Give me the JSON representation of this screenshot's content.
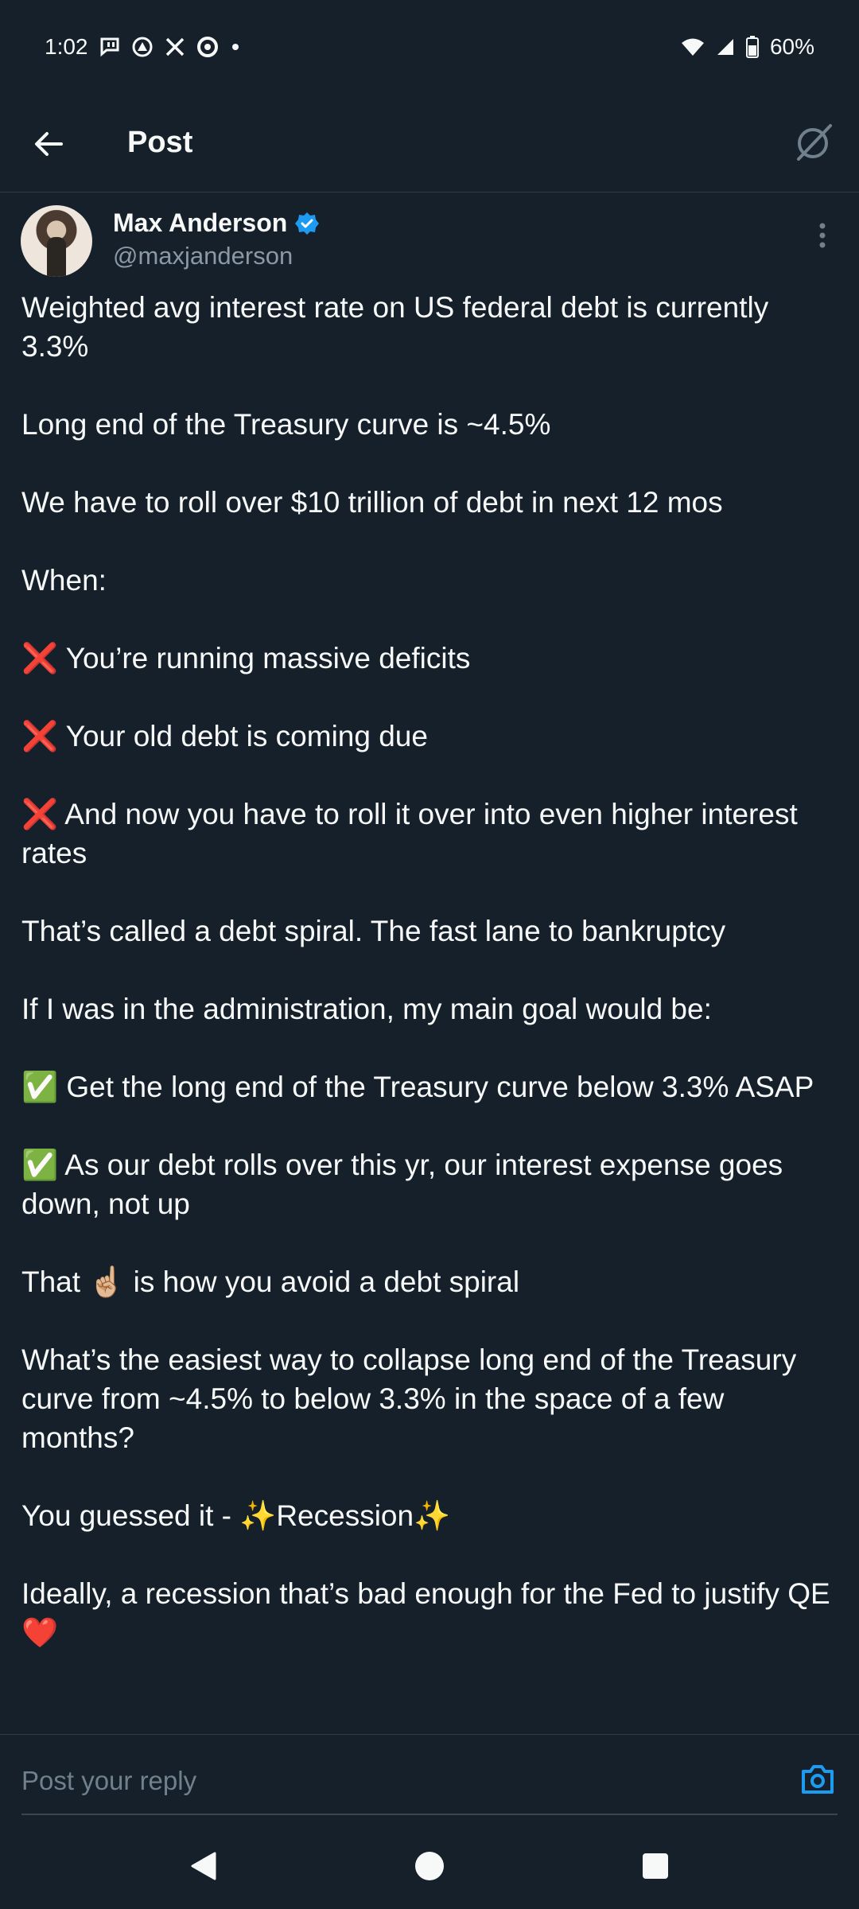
{
  "status_bar": {
    "time": "1:02",
    "battery": "60%",
    "icons": [
      "chat-notification-icon",
      "app-notification-icon",
      "x-icon",
      "circle-app-icon",
      "dot-icon",
      "wifi-icon",
      "signal-icon",
      "battery-icon"
    ]
  },
  "header": {
    "title": "Post",
    "back_icon": "back-arrow-icon",
    "grok_icon": "grok-icon"
  },
  "author": {
    "name": "Max Anderson",
    "handle": "@maxjanderson",
    "verified": true
  },
  "post": {
    "paragraphs": [
      "Weighted avg interest rate on US federal debt is currently 3.3%",
      "Long end of the Treasury curve is ~4.5%",
      "We have to roll over $10 trillion of debt in next 12 mos",
      "When:",
      "❌ You’re running massive deficits",
      "❌ Your old debt is coming due",
      "❌ And now you have to roll it over into even higher interest rates",
      "That’s called a debt spiral. The fast lane to bankruptcy",
      "If I was in the administration, my main goal would be:",
      "✅ Get the long end of the Treasury curve below 3.3% ASAP",
      "✅ As our debt rolls over this yr, our interest expense goes down, not up",
      "That ☝🏼 is how you avoid a debt spiral",
      "What’s the easiest way to collapse long end of the Treasury curve from ~4.5% to below 3.3% in the space of a few months?",
      "You guessed it -  ✨Recession✨",
      "Ideally, a recession that’s bad enough for the Fed to justify QE ❤️"
    ]
  },
  "reply": {
    "placeholder": "Post your reply"
  },
  "colors": {
    "background": "#15202b",
    "accent": "#1d9bf0",
    "text": "#f7f9f9",
    "secondary_text": "#8b98a5"
  }
}
